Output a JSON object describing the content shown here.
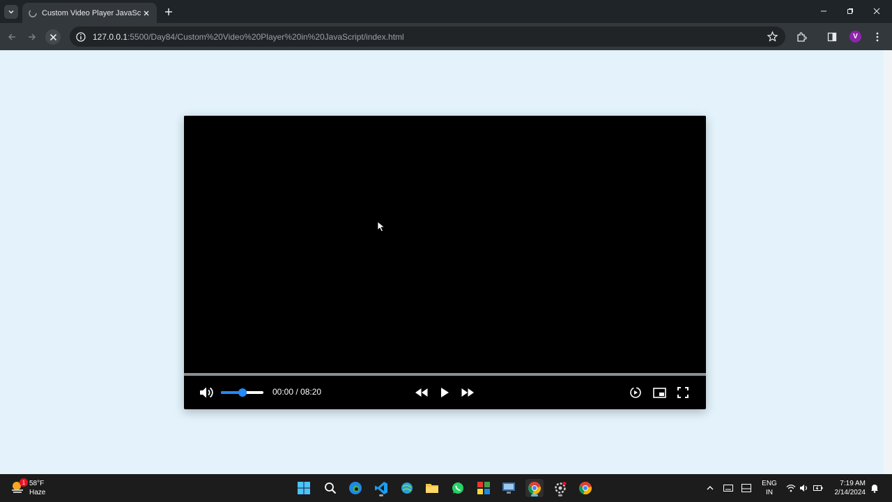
{
  "browser": {
    "tab_title": "Custom Video Player JavaScript",
    "url_host": "127.0.0.1",
    "url_rest": ":5500/Day84/Custom%20Video%20Player%20in%20JavaScript/index.html",
    "profile_initial": "V",
    "accent": "#1f2428"
  },
  "player": {
    "current_time": "00:00",
    "separator": " / ",
    "duration": "08:20",
    "progress_fraction": 0,
    "volume_fraction": 0.5,
    "accent": "#2289ff",
    "icons": {
      "volume": "volume-high-icon",
      "rewind": "rewind-icon",
      "play": "play-icon",
      "forward": "fast-forward-icon",
      "speed": "playback-speed-icon",
      "pip": "picture-in-picture-icon",
      "fullscreen": "fullscreen-icon"
    }
  },
  "taskbar": {
    "weather_temp": "58°F",
    "weather_desc": "Haze",
    "weather_badge": "1",
    "lang_line1": "ENG",
    "lang_line2": "IN",
    "time": "7:19 AM",
    "date": "2/14/2024"
  }
}
